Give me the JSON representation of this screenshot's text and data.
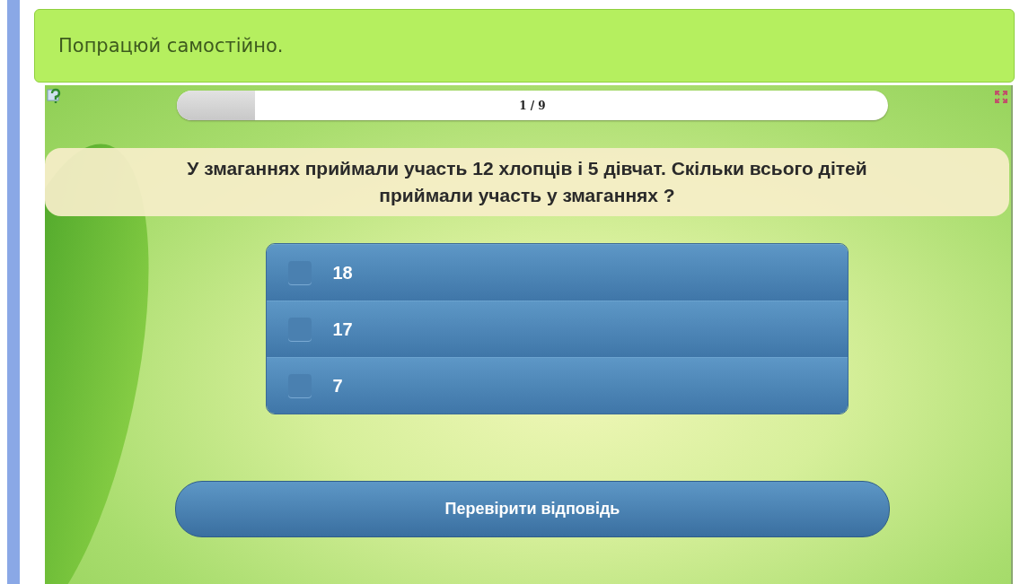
{
  "header": {
    "title": "Попрацюй самостійно."
  },
  "progress": {
    "label": "1 / 9",
    "level": 0.11
  },
  "question": "У змаганнях приймали участь 12 хлопців і 5 дівчат. Скільки всього дітей приймали участь у змаганнях ?",
  "options": [
    {
      "label": "18",
      "checked": false
    },
    {
      "label": "17",
      "checked": false
    },
    {
      "label": "7",
      "checked": false
    }
  ],
  "submit_button": "Перевірити відповідь"
}
